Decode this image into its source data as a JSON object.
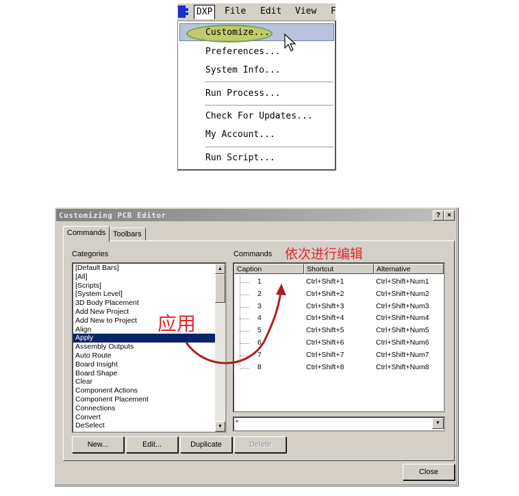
{
  "menubar": {
    "dxp": "DXP",
    "file": "File",
    "edit": "Edit",
    "view": "View",
    "more": "F"
  },
  "dxp_menu": [
    {
      "label": "Customize..."
    },
    {
      "label": "Preferences..."
    },
    {
      "label": "System Info..."
    },
    {
      "label": "Run Process..."
    },
    {
      "label": "Check For Updates..."
    },
    {
      "label": "My Account..."
    },
    {
      "label": "Run Script..."
    }
  ],
  "dialog": {
    "title": "Customizing PCB Editor",
    "help_btn": "?",
    "close_btn": "×",
    "tabs": [
      "Commands",
      "Toolbars"
    ],
    "categories_label": "Categories",
    "commands_label": "Commands",
    "categories": [
      "[Default Bars]",
      "[All]",
      "[Scripts]",
      "[System Level]",
      "3D Body Placement",
      "Add New Project",
      "Add New to Project",
      "Align",
      "Apply",
      "Assembly Outputs",
      "Auto Route",
      "Board Insight",
      "Board Shape",
      "Clear",
      "Component Actions",
      "Component Placement",
      "Connections",
      "Convert",
      "DeSelect"
    ],
    "selected_category": "Apply",
    "columns": [
      "Caption",
      "Shortcut",
      "Alternative"
    ],
    "rows": [
      {
        "caption": "1",
        "shortcut": "Ctrl+Shift+1",
        "alternative": "Ctrl+Shift+Num1"
      },
      {
        "caption": "2",
        "shortcut": "Ctrl+Shift+2",
        "alternative": "Ctrl+Shift+Num2"
      },
      {
        "caption": "3",
        "shortcut": "Ctrl+Shift+3",
        "alternative": "Ctrl+Shift+Num3"
      },
      {
        "caption": "4",
        "shortcut": "Ctrl+Shift+4",
        "alternative": "Ctrl+Shift+Num4"
      },
      {
        "caption": "5",
        "shortcut": "Ctrl+Shift+5",
        "alternative": "Ctrl+Shift+Num5"
      },
      {
        "caption": "6",
        "shortcut": "Ctrl+Shift+6",
        "alternative": "Ctrl+Shift+Num6"
      },
      {
        "caption": "7",
        "shortcut": "Ctrl+Shift+7",
        "alternative": "Ctrl+Shift+Num7"
      },
      {
        "caption": "8",
        "shortcut": "Ctrl+Shift+8",
        "alternative": "Ctrl+Shift+Num8"
      }
    ],
    "filter_value": "*",
    "buttons": {
      "new": "New...",
      "edit": "Edit...",
      "duplicate": "Duplicate",
      "delete": "Delete",
      "close": "Close"
    }
  },
  "annotations": {
    "edit_in_order": "依次进行编辑",
    "apply": "应用",
    "color": "#e3252e"
  },
  "colors": {
    "selection": "#0a246a",
    "highlight_ellipse": "#c6cc46",
    "face": "#d4d0c8"
  }
}
